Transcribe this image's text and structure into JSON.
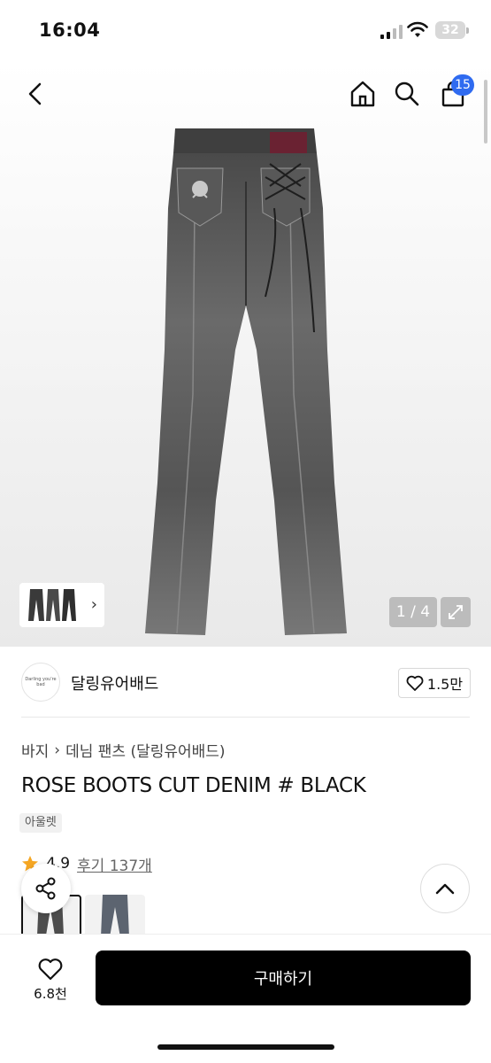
{
  "status_bar": {
    "time": "16:04",
    "battery": "32"
  },
  "nav": {
    "cart_count": "15"
  },
  "gallery": {
    "counter": "1 / 4"
  },
  "brand": {
    "name": "달링유어배드",
    "logo_text": "Darling you're bad",
    "likes": "1.5만"
  },
  "breadcrumb": {
    "level1": "바지",
    "level2": "데님 팬츠 (달링유어배드)"
  },
  "product": {
    "title": "ROSE BOOTS CUT DENIM # BLACK",
    "tag": "아울렛",
    "rating": "4.9",
    "reviews": "후기 137개"
  },
  "bottom_bar": {
    "wish_count": "6.8천",
    "buy_label": "구매하기"
  },
  "colors": {
    "accent_badge": "#2f6bf0",
    "star": "#f5a623",
    "buy_button": "#000000"
  }
}
